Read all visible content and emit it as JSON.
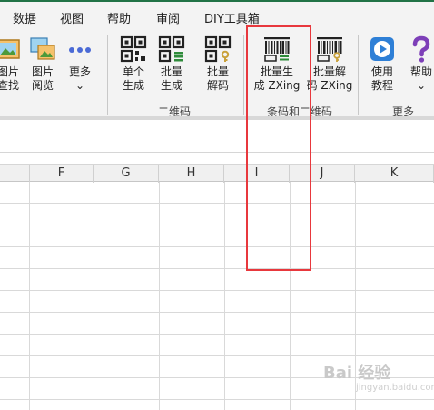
{
  "tabs": [
    "数据",
    "视图",
    "帮助",
    "审阅",
    "DIY工具箱"
  ],
  "ribbon": {
    "buttons": {
      "image_find": "图片\n查找",
      "image_view": "图片\n阅览",
      "more": "更多\n⌄",
      "single_gen": "单个\n生成",
      "batch_gen": "批量\n生成",
      "batch_decode": "批量\n解码",
      "batch_gen_zxing": "批量生\n成 ZXing",
      "batch_decode_zxing": "批量解\n码 ZXing",
      "tutorial": "使用\n教程",
      "help": "帮助\n⌄"
    },
    "groups": {
      "qrcode": "二维码",
      "barcode_qrcode": "条码和二维码",
      "more": "更多"
    },
    "icons": {
      "image_find": "image-search-icon",
      "image_view": "image-gallery-icon",
      "more": "ellipsis-icon",
      "qrcode": "qrcode-icon",
      "barcode": "barcode-icon",
      "tutorial": "play-icon",
      "help": "question-mark-icon"
    }
  },
  "columns": [
    "F",
    "G",
    "H",
    "I",
    "J",
    "K"
  ],
  "watermark": {
    "main": "Bai 经验",
    "sub": "jingyan.baidu.com"
  },
  "colors": {
    "accent": "#217346",
    "highlight": "#e8383d",
    "play_icon": "#2e7fd6",
    "help_icon": "#7d3fb8"
  }
}
